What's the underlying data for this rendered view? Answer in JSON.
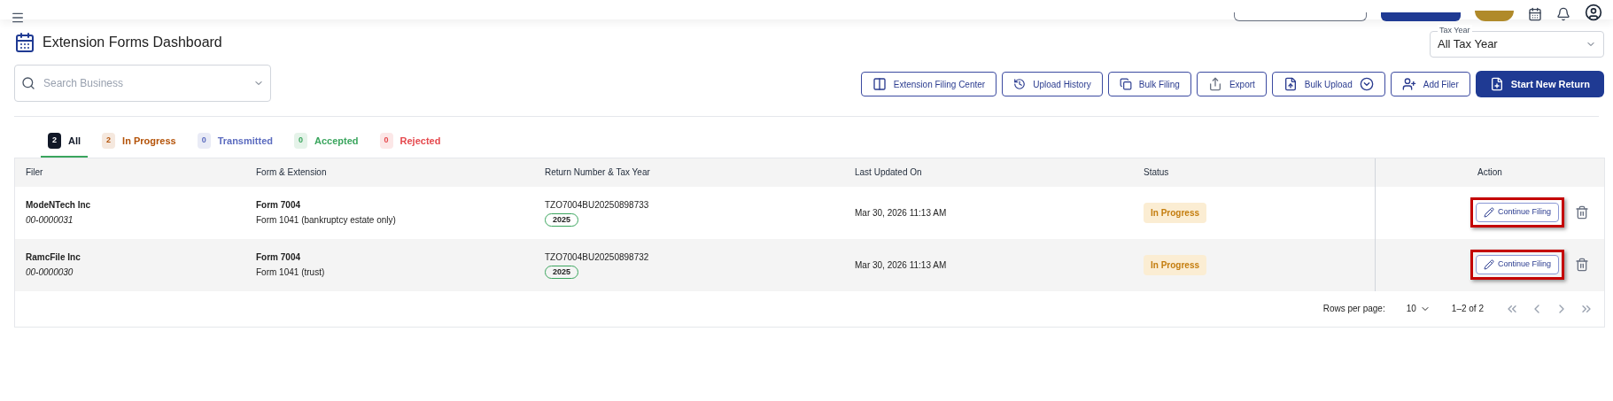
{
  "page": {
    "title": "Extension Forms Dashboard"
  },
  "tax_year": {
    "label": "Tax Year",
    "value": "All Tax Year"
  },
  "search": {
    "placeholder": "Search Business"
  },
  "actions": [
    {
      "label": "Extension Filing Center",
      "kind": "center"
    },
    {
      "label": "Upload History",
      "kind": "history"
    },
    {
      "label": "Bulk Filing",
      "kind": "copy"
    },
    {
      "label": "Export",
      "kind": "export"
    },
    {
      "label": "Bulk Upload",
      "kind": "upload"
    },
    {
      "label": "Add Filer",
      "kind": "adduser"
    },
    {
      "label": "Start New Return",
      "kind": "primary"
    }
  ],
  "tabs": [
    {
      "count": "2",
      "label": "All",
      "selected": true,
      "color": "#111827"
    },
    {
      "count": "2",
      "label": "In Progress",
      "selected": false,
      "color": "#b45309"
    },
    {
      "count": "0",
      "label": "Transmitted",
      "selected": false,
      "color": "#5b6bbf"
    },
    {
      "count": "0",
      "label": "Accepted",
      "selected": false,
      "color": "#3aa55d"
    },
    {
      "count": "0",
      "label": "Rejected",
      "selected": false,
      "color": "#e5484d"
    }
  ],
  "table": {
    "columns": [
      "Filer",
      "Form & Extension",
      "Return Number & Tax Year",
      "Last Updated On",
      "Status",
      "Action"
    ],
    "rows": [
      {
        "filer": "ModeNTech Inc",
        "ein": "00-0000031",
        "form": "Form 7004",
        "extension": "Form 1041 (bankruptcy estate only)",
        "return_number": "TZO7004BU20250898733",
        "tax_year": "2025",
        "updated": "Mar 30, 2026 11:13 AM",
        "status": "In Progress",
        "action": "Continue Filing",
        "highlighted": true
      },
      {
        "filer": "RamcFile Inc",
        "ein": "00-0000030",
        "form": "Form 7004",
        "extension": "Form 1041 (trust)",
        "return_number": "TZO7004BU20250898732",
        "tax_year": "2025",
        "updated": "Mar 30, 2026 11:13 AM",
        "status": "In Progress",
        "action": "Continue Filing",
        "highlighted": true
      }
    ]
  },
  "pagination": {
    "rows_label": "Rows per page:",
    "rows_value": "10",
    "range": "1–2 of 2"
  }
}
